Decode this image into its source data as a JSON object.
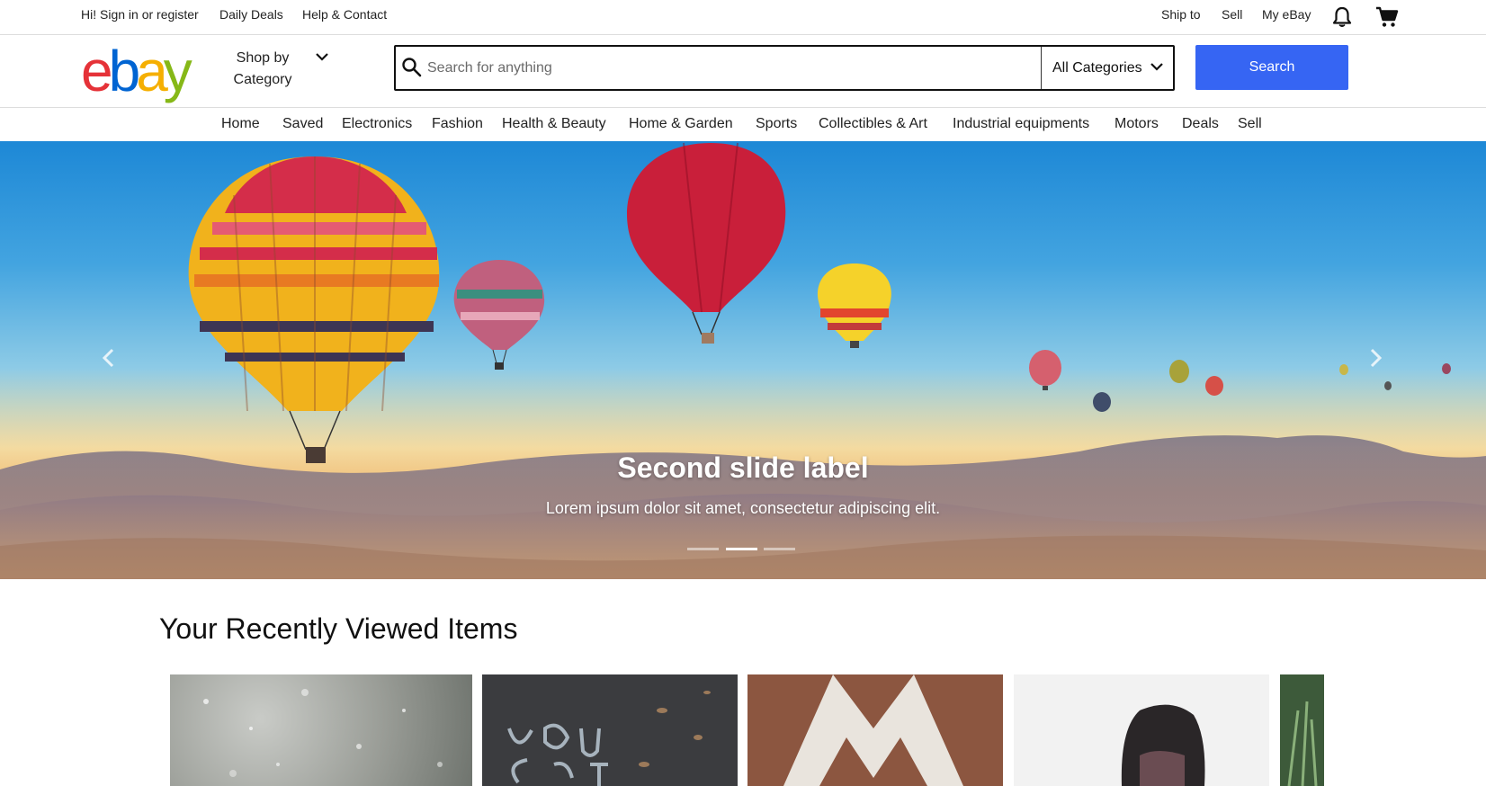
{
  "topbar": {
    "signin": "Hi! Sign in or register",
    "daily_deals": "Daily Deals",
    "help": "Help & Contact",
    "ship_to": "Ship to",
    "sell": "Sell",
    "my_ebay": "My eBay"
  },
  "header": {
    "logo_letters": [
      "e",
      "b",
      "a",
      "y"
    ],
    "logo_colors": [
      "#e53238",
      "#0064d2",
      "#f5af02",
      "#86b817"
    ],
    "shop_by_category": "Shop by Category",
    "search_placeholder": "Search for anything",
    "search_value": "",
    "category_select": "All Categories",
    "search_button": "Search",
    "accent_color": "#3665f3"
  },
  "nav": {
    "items": [
      "Home",
      "Saved",
      "Electronics",
      "Fashion",
      "Health & Beauty",
      "Home & Garden",
      "Sports",
      "Collectibles & Art",
      "Industrial equipments",
      "Motors",
      "Deals",
      "Sell"
    ]
  },
  "carousel": {
    "slide_title": "Second slide label",
    "slide_text": "Lorem ipsum dolor sit amet, consectetur adipiscing elit.",
    "slide_count": 3,
    "active_slide": 2
  },
  "recently_viewed": {
    "title": "Your Recently Viewed Items"
  }
}
